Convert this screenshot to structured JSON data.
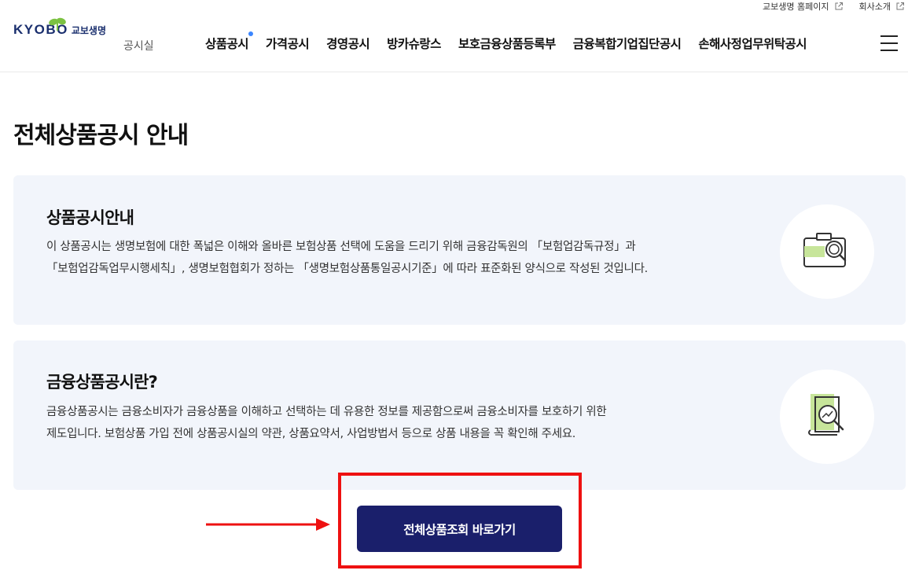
{
  "util": {
    "homepage_label": "교보생명 홈페이지",
    "company_label": "회사소개"
  },
  "brand": {
    "logo_en": "KYOBO",
    "logo_ko": "교보생명",
    "section_label": "공시실",
    "color_navy": "#1a2f6e",
    "color_leaf": "#7cc242"
  },
  "nav": {
    "items": [
      {
        "label": "상품공시"
      },
      {
        "label": "가격공시"
      },
      {
        "label": "경영공시"
      },
      {
        "label": "방카슈랑스"
      },
      {
        "label": "보호금융상품등록부"
      },
      {
        "label": "금융복합기업집단공시"
      },
      {
        "label": "손해사정업무위탁공시"
      }
    ],
    "active_dot_color": "#3b86ff"
  },
  "page": {
    "title": "전체상품공시 안내"
  },
  "cards": [
    {
      "title": "상품공시안내",
      "line1": "이 상품공시는 생명보험에 대한 폭넓은 이해와 올바른 보험상품 선택에 도움을 드리기 위해 금융감독원의 「보험업감독규정」과",
      "line2": "「보험업감독업무시행세칙」, 생명보험협회가 정하는 「생명보험상품통일공시기준」에 따라 표준화된 양식으로 작성된 것입니다.",
      "icon": "camera-search-icon"
    },
    {
      "title": "금융상품공시란?",
      "line1": "금융상품공시는 금융소비자가 금융상품을 이해하고 선택하는 데 유용한 정보를 제공함으로써 금융소비자를 보호하기 위한",
      "line2": "제도입니다. 보험상품 가입 전에 상품공시실의 약관, 상품요약서, 사업방법서 등으로 상품 내용을 꼭 확인해 주세요.",
      "icon": "document-chart-search-icon"
    }
  ],
  "cta": {
    "label": "전체상품조회 바로가기",
    "color": "#1a1f6b"
  },
  "annotation": {
    "highlight_color": "#ee1111"
  }
}
